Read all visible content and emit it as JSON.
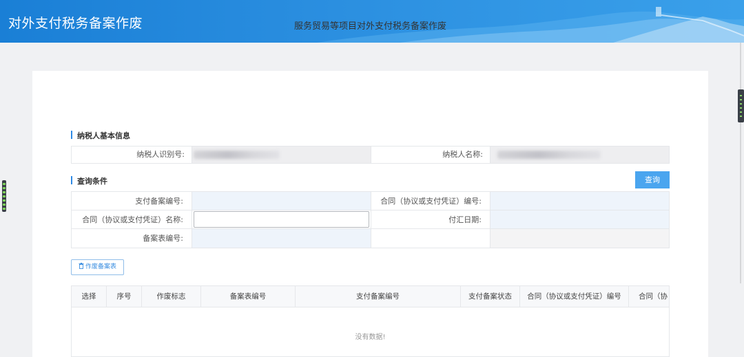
{
  "header": {
    "title": "对外支付税务备案作废"
  },
  "page": {
    "title": "服务贸易等项目对外支付税务备案作废"
  },
  "basic_info": {
    "section_title": "纳税人基本信息",
    "taxpayer_id_label": "纳税人识别号:",
    "taxpayer_name_label": "纳税人名称:"
  },
  "query": {
    "section_title": "查询条件",
    "button_label": "查询",
    "fields": {
      "payment_record_no": "支付备案编号:",
      "contract_no": "合同（协议或支付凭证）编号:",
      "contract_name": "合同（协议或支付凭证）名称:",
      "remit_date": "付汇日期:",
      "form_no": "备案表编号:"
    }
  },
  "actions": {
    "void_button": "作废备案表"
  },
  "grid": {
    "columns": [
      "选择",
      "序号",
      "作废标志",
      "备案表编号",
      "支付备案编号",
      "支付备案状态",
      "合同（协议或支付凭证）编号",
      "合同（协"
    ],
    "empty_text": "没有数据!"
  },
  "colors": {
    "header_blue": "#1a7fd6",
    "accent": "#2f8ae5",
    "button": "#4aa5ef"
  }
}
